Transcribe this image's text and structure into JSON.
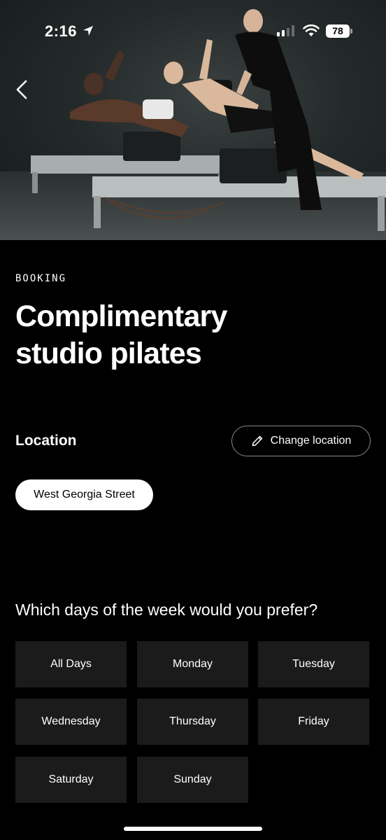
{
  "status_bar": {
    "time": "2:16",
    "battery": "78"
  },
  "icons": {
    "back": "chevron-left-icon",
    "location_arrow": "location-arrow-icon",
    "signal": "cellular-signal-icon",
    "wifi": "wifi-icon",
    "pencil": "pencil-icon"
  },
  "header": {
    "eyebrow": "BOOKING",
    "title": "Complimentary studio pilates"
  },
  "location": {
    "label": "Location",
    "change_button": "Change location",
    "selected": "West Georgia Street"
  },
  "days": {
    "question": "Which days of the week would you prefer?",
    "options": [
      "All Days",
      "Monday",
      "Tuesday",
      "Wednesday",
      "Thursday",
      "Friday",
      "Saturday",
      "Sunday"
    ]
  },
  "colors": {
    "background": "#000000",
    "tile": "#1b1b1b",
    "text": "#ffffff",
    "chip_bg": "#ffffff",
    "chip_text": "#000000"
  }
}
